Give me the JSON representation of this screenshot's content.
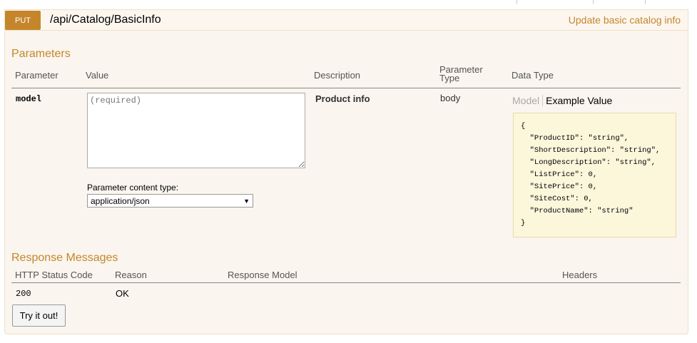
{
  "operation": {
    "method": "PUT",
    "path": "/api/Catalog/BasicInfo",
    "summary": "Update basic catalog info"
  },
  "parameters": {
    "title": "Parameters",
    "columns": {
      "parameter": "Parameter",
      "value": "Value",
      "description": "Description",
      "param_type_line1": "Parameter",
      "param_type_line2": "Type",
      "data_type": "Data Type"
    },
    "row": {
      "name": "model",
      "value": "",
      "placeholder": "(required)",
      "description": "Product info",
      "param_type": "body",
      "content_type_label": "Parameter content type:",
      "content_type_selected": "application/json"
    },
    "data_type": {
      "tab_model": "Model",
      "tab_example": "Example Value",
      "example": "{\n  \"ProductID\": \"string\",\n  \"ShortDescription\": \"string\",\n  \"LongDescription\": \"string\",\n  \"ListPrice\": 0,\n  \"SitePrice\": 0,\n  \"SiteCost\": 0,\n  \"ProductName\": \"string\"\n}"
    }
  },
  "responses": {
    "title": "Response Messages",
    "columns": {
      "status": "HTTP Status Code",
      "reason": "Reason",
      "model": "Response Model",
      "headers": "Headers"
    },
    "rows": [
      {
        "status": "200",
        "reason": "OK"
      }
    ]
  },
  "actions": {
    "try_label": "Try it out!"
  },
  "colors": {
    "accent": "#c5862b",
    "panel_bg": "#faf5ee",
    "example_bg": "#fcf6db"
  }
}
